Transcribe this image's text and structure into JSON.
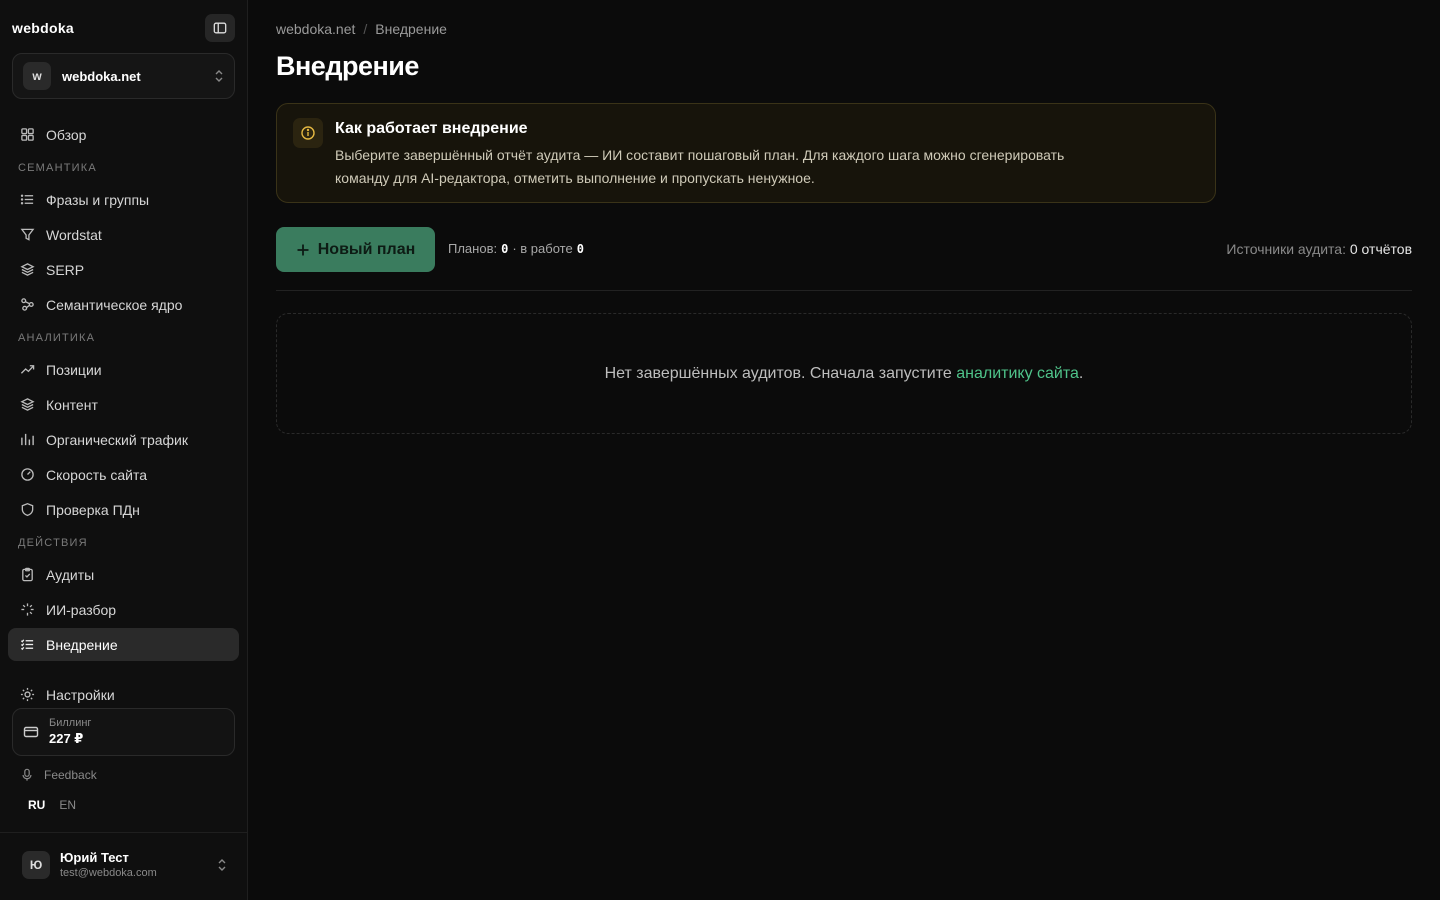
{
  "sidebar": {
    "brand": "webdoka",
    "site": {
      "avatar": "w",
      "name": "webdoka.net"
    },
    "overview": "Обзор",
    "sections": {
      "semantics": "СЕМАНТИКА",
      "analytics": "АНАЛИТИКА",
      "actions": "ДЕЙСТВИЯ"
    },
    "items": {
      "phrases": "Фразы и группы",
      "wordstat": "Wordstat",
      "serp": "SERP",
      "core": "Семантическое ядро",
      "positions": "Позиции",
      "content": "Контент",
      "traffic": "Органический трафик",
      "speed": "Скорость сайта",
      "pdn": "Проверка ПДн",
      "audits": "Аудиты",
      "ai": "ИИ-разбор",
      "implementation": "Внедрение",
      "settings": "Настройки"
    },
    "billing": {
      "label": "Биллинг",
      "value": "227 ₽"
    },
    "feedback": "Feedback",
    "lang": {
      "ru": "RU",
      "en": "EN"
    },
    "user": {
      "avatar": "Ю",
      "name": "Юрий Тест",
      "email": "test@webdoka.com"
    }
  },
  "main": {
    "breadcrumb": {
      "root": "webdoka.net",
      "sep": "/",
      "current": "Внедрение"
    },
    "title": "Внедрение",
    "info": {
      "title": "Как работает внедрение",
      "line1": "Выберите завершённый отчёт аудита — ИИ составит пошаговый план. Для каждого шага можно сгенерировать",
      "line2": "команду для AI-редактора, отметить выполнение и пропускать ненужное."
    },
    "new_plan": "Новый план",
    "plans": {
      "label": "Планов:",
      "count": "0",
      "mid": "· в работе",
      "in_work": "0"
    },
    "sources": {
      "label": "Источники аудита:",
      "value": "0 отчётов"
    },
    "empty": {
      "text": "Нет завершённых аудитов. Сначала запустите ",
      "link": "аналитику сайта",
      "end": "."
    }
  },
  "colors": {
    "accent": "#3a7c5e",
    "link": "#4fc38a",
    "info_bg": "#17140b"
  }
}
